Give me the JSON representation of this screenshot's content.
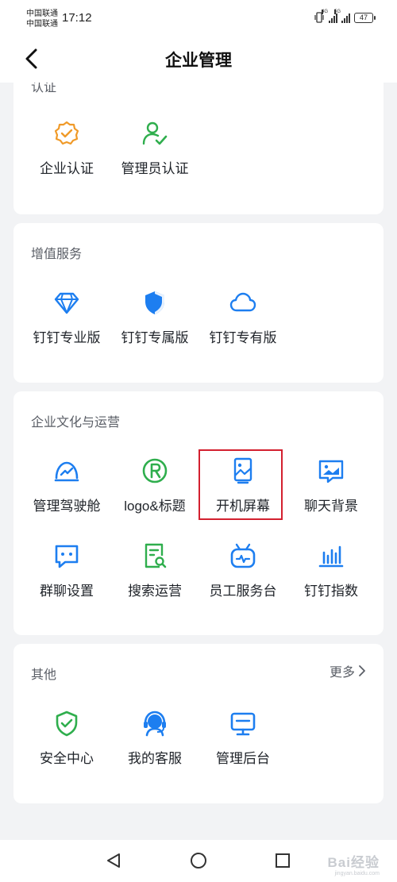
{
  "status_bar": {
    "carrier_1": "中国联通",
    "carrier_2": "中国联通",
    "time": "17:12",
    "signal_1_tag": "4G",
    "signal_2_tag": "5G",
    "battery": "47"
  },
  "nav": {
    "title": "企业管理"
  },
  "sections": {
    "auth": {
      "title": "认证",
      "items": [
        {
          "label": "企业认证",
          "icon": "badge-check-icon"
        },
        {
          "label": "管理员认证",
          "icon": "user-check-icon"
        }
      ]
    },
    "value_added": {
      "title": "增值服务",
      "items": [
        {
          "label": "钉钉专业版",
          "icon": "diamond-icon"
        },
        {
          "label": "钉钉专属版",
          "icon": "shield-icon"
        },
        {
          "label": "钉钉专有版",
          "icon": "cloud-icon"
        }
      ]
    },
    "culture": {
      "title": "企业文化与运营",
      "items": [
        {
          "label": "管理驾驶舱",
          "icon": "gauge-icon"
        },
        {
          "label": "logo&标题",
          "icon": "registered-icon"
        },
        {
          "label": "开机屏幕",
          "icon": "image-screen-icon"
        },
        {
          "label": "聊天背景",
          "icon": "chat-background-icon"
        },
        {
          "label": "群聊设置",
          "icon": "chat-bubble-icon"
        },
        {
          "label": "搜索运营",
          "icon": "search-document-icon"
        },
        {
          "label": "员工服务台",
          "icon": "robot-icon"
        },
        {
          "label": "钉钉指数",
          "icon": "bar-chart-icon"
        }
      ]
    },
    "other": {
      "title": "其他",
      "more": "更多",
      "items": [
        {
          "label": "安全中心",
          "icon": "shield-check-icon"
        },
        {
          "label": "我的客服",
          "icon": "headset-icon"
        },
        {
          "label": "管理后台",
          "icon": "monitor-icon"
        }
      ]
    }
  },
  "watermark": {
    "text": "Bai经验",
    "sub": "jingyan.baidu.com"
  },
  "colors": {
    "blue": "#1d7ef0",
    "green": "#2fae4d",
    "orange": "#f09a28",
    "highlight": "#d3202f"
  }
}
